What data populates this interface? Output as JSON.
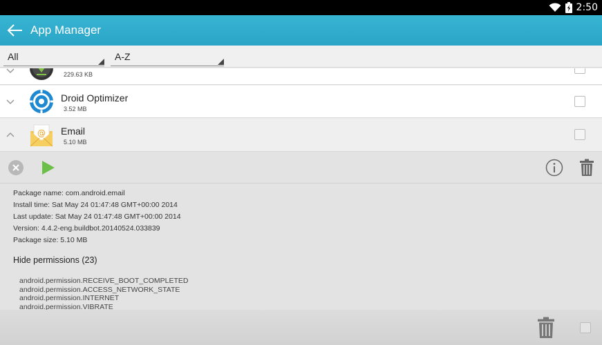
{
  "status_bar": {
    "time": "2:50"
  },
  "header": {
    "title": "App Manager"
  },
  "filters": {
    "category": "All",
    "sort": "A-Z"
  },
  "apps": [
    {
      "name": "",
      "size": "229.63 KB"
    },
    {
      "name": "Droid Optimizer",
      "size": "3.52 MB"
    },
    {
      "name": "Email",
      "size": "5.10 MB"
    }
  ],
  "details": {
    "package_name": "Package name: com.android.email",
    "install_time": "Install time: Sat May 24 01:47:48 GMT+00:00 2014",
    "last_update": "Last update: Sat May 24 01:47:48 GMT+00:00 2014",
    "version": "Version: 4.4.2-eng.buildbot.20140524.033839",
    "package_size": "Package size: 5.10 MB",
    "permissions_toggle": "Hide permissions (23)",
    "permissions": [
      "android.permission.RECEIVE_BOOT_COMPLETED",
      "android.permission.ACCESS_NETWORK_STATE",
      "android.permission.INTERNET",
      "android.permission.VIBRATE"
    ]
  },
  "colors": {
    "accent": "#2aa5c6",
    "play": "#6cc04a",
    "panel": "#e3e3e3"
  }
}
